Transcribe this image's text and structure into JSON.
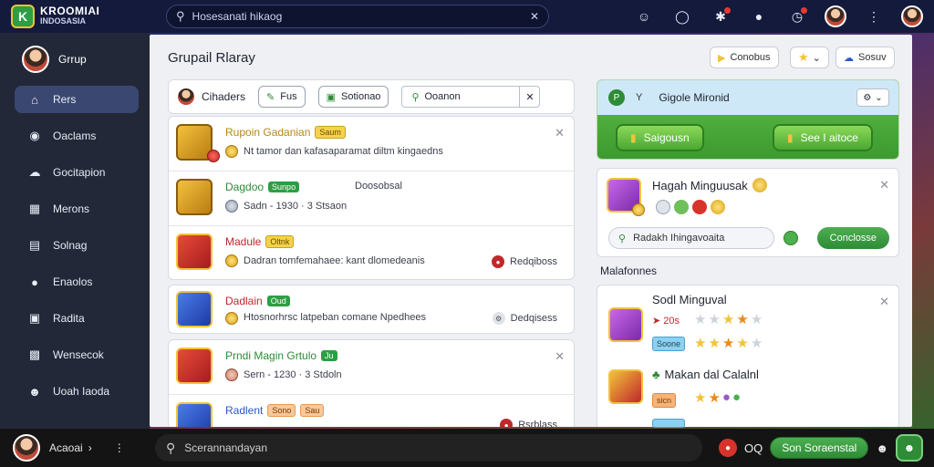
{
  "topbar": {
    "logo_line1": "KROOMIAI",
    "logo_line2": "INDOSASIA",
    "search_text": "Hosesanati hikaog"
  },
  "sidebar": {
    "user_name": "Grrup",
    "items": [
      {
        "label": "Rers",
        "icon": "home-icon",
        "active": true
      },
      {
        "label": "Oaclams",
        "icon": "location-icon"
      },
      {
        "label": "Gocitapion",
        "icon": "cloud-icon"
      },
      {
        "label": "Merons",
        "icon": "building-icon"
      },
      {
        "label": "Solnag",
        "icon": "calendar-icon"
      },
      {
        "label": "Enaolos",
        "icon": "chat-icon"
      },
      {
        "label": "Radita",
        "icon": "document-icon"
      },
      {
        "label": "Wensecok",
        "icon": "grid-icon"
      },
      {
        "label": "Uoah Iaoda",
        "icon": "group-icon"
      }
    ]
  },
  "bottombar": {
    "user_name": "Acaoai",
    "search_text": "Scerannandayan",
    "badge": "OQ",
    "button": "Son Soraenstal"
  },
  "main": {
    "title": "Grupail Rlaray",
    "header_buttons": [
      "Conobus",
      "",
      "Sosuv"
    ],
    "filter": {
      "label": "Cihaders",
      "chip1": "Fus",
      "chip2": "Sotionao",
      "select_value": "Ooanon"
    },
    "rows": [
      {
        "title": "Rupoin Gadanian",
        "tag": "Saum",
        "sub": "Nt tamor dan kafasaparamat diltm kingaedns"
      },
      {
        "title": "Dagdoo",
        "tag_green": "Sunpo",
        "mid": "Doosobsal",
        "sub": "Sadn - 1930 · 3 Stsaon"
      },
      {
        "title": "Madule",
        "tag": "Oltnk",
        "sub": "Dadran tomfemahaee: kant dlomedeanis",
        "right": "Redqiboss"
      },
      {
        "title": "Dadlain",
        "tag": "Oud",
        "sub": "Htosnorhrsc latpeban comane Npedhees",
        "right": "Dedqisess"
      },
      {
        "title": "Prndi Magin Grtulo",
        "tag_green": "Ju",
        "sub": "Sern - 1230 · 3 Stdoln"
      },
      {
        "title": "Radlent",
        "tag": "Sono",
        "tag2": "Sau",
        "sub": "",
        "right": "Rsrblass"
      }
    ],
    "promo": {
      "left_label": "Y",
      "title": "Gigole Mironid",
      "btn1": "Saigousn",
      "btn2": "See I aitoce"
    },
    "gift_card": {
      "title": "Hagah Minguusak",
      "input_text": "Radakh Ihingavoaita",
      "button": "Conclosse"
    },
    "milestones_label": "Malafonnes",
    "milestone1": {
      "title": "Sodl Minguval",
      "value": "20s",
      "badge": "Soone"
    },
    "milestone2": {
      "title": "Makan dal Calalnl",
      "badge": "sicn"
    },
    "colors": {
      "accent_green": "#2e8b36",
      "gold": "#f2c23c",
      "sidebar": "#222838"
    }
  }
}
